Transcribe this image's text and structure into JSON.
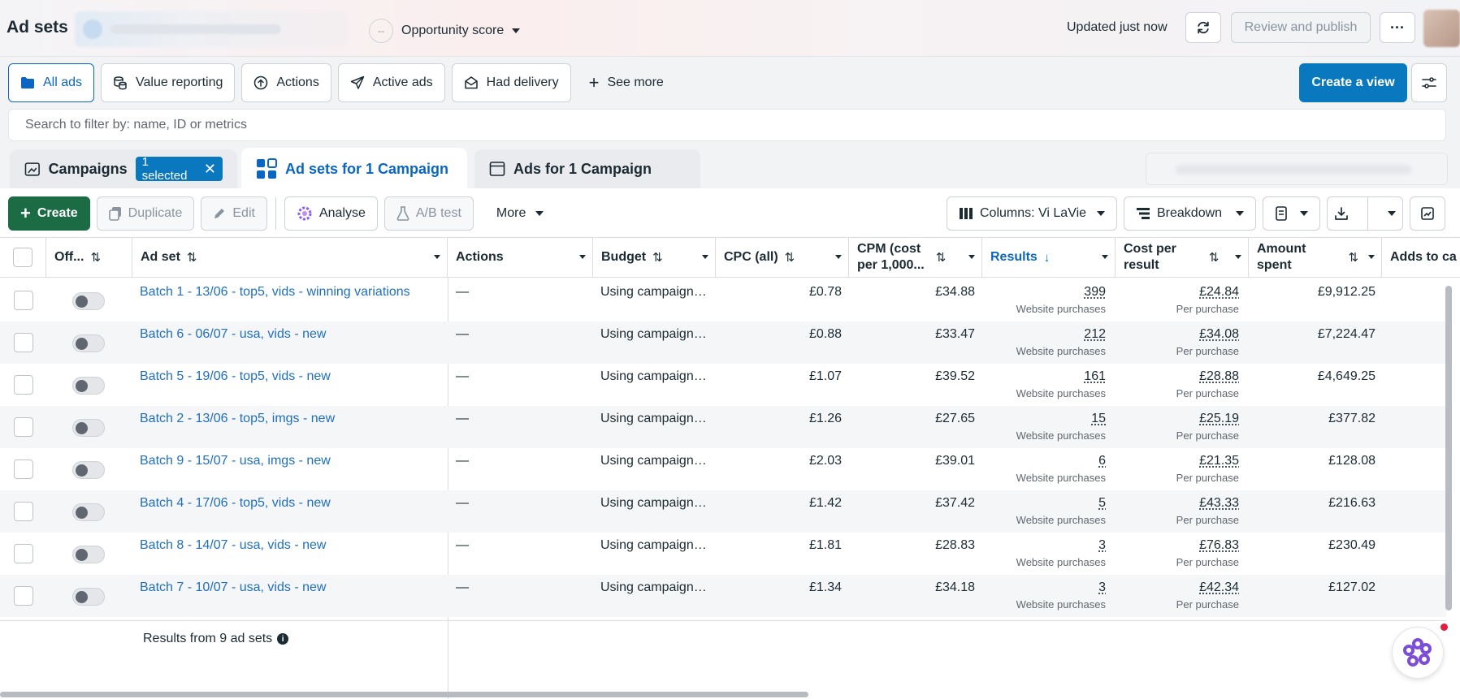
{
  "header": {
    "title": "Ad sets",
    "opportunity_score": {
      "value": "--",
      "label": "Opportunity score"
    },
    "updated": "Updated just now",
    "review_publish": "Review and publish",
    "more": "···"
  },
  "filters": {
    "items": [
      {
        "label": "All ads",
        "icon": "folder-icon",
        "active": true
      },
      {
        "label": "Value reporting",
        "icon": "coins-icon"
      },
      {
        "label": "Actions",
        "icon": "upload-icon"
      },
      {
        "label": "Active ads",
        "icon": "send-icon"
      },
      {
        "label": "Had delivery",
        "icon": "envelope-icon"
      }
    ],
    "see_more": "See more",
    "create_view": "Create a view"
  },
  "search": {
    "placeholder": "Search to filter by: name, ID or metrics"
  },
  "tabs": {
    "campaigns": "Campaigns",
    "selected_chip": "1 selected",
    "adsets": "Ad sets for 1 Campaign",
    "ads": "Ads for 1 Campaign"
  },
  "toolbar": {
    "create": "Create",
    "duplicate": "Duplicate",
    "edit": "Edit",
    "analyse": "Analyse",
    "ab_test": "A/B test",
    "more": "More",
    "columns": "Columns: Vi LaVie",
    "breakdown": "Breakdown"
  },
  "table": {
    "headers": {
      "off": "Off...",
      "adset": "Ad set",
      "actions": "Actions",
      "budget": "Budget",
      "cpc": "CPC (all)",
      "cpm_1": "CPM (cost",
      "cpm_2": "per 1,000...",
      "results": "Results",
      "cpr_1": "Cost per",
      "cpr_2": "result",
      "amount_1": "Amount",
      "amount_2": "spent",
      "adds": "Adds to ca"
    },
    "rows": [
      {
        "name": "Batch 1 - 13/06 - top5, vids - winning variations",
        "actions": "—",
        "budget": "Using campaign…",
        "cpc": "£0.78",
        "cpm": "£34.88",
        "results": "399",
        "results_sub": "Website purchases",
        "cpr": "£24.84",
        "cpr_sub": "Per purchase",
        "amount": "£9,912.25"
      },
      {
        "name": "Batch 6 - 06/07 - usa, vids - new",
        "actions": "—",
        "budget": "Using campaign…",
        "cpc": "£0.88",
        "cpm": "£33.47",
        "results": "212",
        "results_sub": "Website purchases",
        "cpr": "£34.08",
        "cpr_sub": "Per purchase",
        "amount": "£7,224.47"
      },
      {
        "name": "Batch 5 - 19/06 - top5, vids - new",
        "actions": "—",
        "budget": "Using campaign…",
        "cpc": "£1.07",
        "cpm": "£39.52",
        "results": "161",
        "results_sub": "Website purchases",
        "cpr": "£28.88",
        "cpr_sub": "Per purchase",
        "amount": "£4,649.25"
      },
      {
        "name": "Batch 2 - 13/06 - top5, imgs - new",
        "actions": "—",
        "budget": "Using campaign…",
        "cpc": "£1.26",
        "cpm": "£27.65",
        "results": "15",
        "results_sub": "Website purchases",
        "cpr": "£25.19",
        "cpr_sub": "Per purchase",
        "amount": "£377.82"
      },
      {
        "name": "Batch 9 - 15/07 - usa, imgs - new",
        "actions": "—",
        "budget": "Using campaign…",
        "cpc": "£2.03",
        "cpm": "£39.01",
        "results": "6",
        "results_sub": "Website purchases",
        "cpr": "£21.35",
        "cpr_sub": "Per purchase",
        "amount": "£128.08"
      },
      {
        "name": "Batch 4 - 17/06 - top5, vids - new",
        "actions": "—",
        "budget": "Using campaign…",
        "cpc": "£1.42",
        "cpm": "£37.42",
        "results": "5",
        "results_sub": "Website purchases",
        "cpr": "£43.33",
        "cpr_sub": "Per purchase",
        "amount": "£216.63"
      },
      {
        "name": "Batch 8 - 14/07 - usa, vids - new",
        "actions": "—",
        "budget": "Using campaign…",
        "cpc": "£1.81",
        "cpm": "£28.83",
        "results": "3",
        "results_sub": "Website purchases",
        "cpr": "£76.83",
        "cpr_sub": "Per purchase",
        "amount": "£230.49"
      },
      {
        "name": "Batch 7 - 10/07 - usa, vids - new",
        "actions": "—",
        "budget": "Using campaign…",
        "cpc": "£1.34",
        "cpm": "£34.18",
        "results": "3",
        "results_sub": "Website purchases",
        "cpr": "£42.34",
        "cpr_sub": "Per purchase",
        "amount": "£127.02"
      }
    ],
    "footer": "Results from 9 ad sets"
  },
  "colors": {
    "accent": "#0a66c2",
    "create_green": "#1b6b44",
    "create_view_blue": "#0a78be"
  }
}
